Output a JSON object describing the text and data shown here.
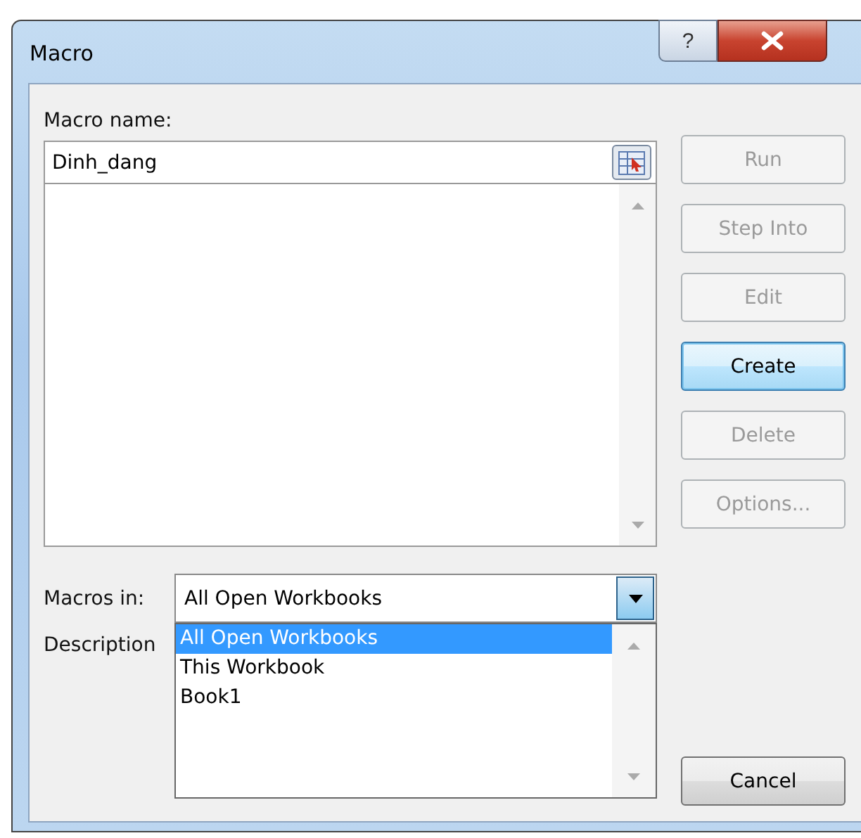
{
  "window": {
    "title": "Macro",
    "help_label": "?"
  },
  "macro_name": {
    "label": "Macro name:",
    "value": "Dinh_dang"
  },
  "buttons": [
    {
      "label": "Run",
      "disabled": true,
      "focused": false
    },
    {
      "label": "Step Into",
      "disabled": true,
      "focused": false
    },
    {
      "label": "Edit",
      "disabled": true,
      "focused": false
    },
    {
      "label": "Create",
      "disabled": false,
      "focused": true
    },
    {
      "label": "Delete",
      "disabled": true,
      "focused": false
    },
    {
      "label": "Options...",
      "disabled": true,
      "focused": false
    }
  ],
  "macros_in": {
    "label": "Macros in:",
    "value": "All Open Workbooks",
    "expanded": true,
    "options": [
      {
        "label": "All Open Workbooks",
        "selected": true
      },
      {
        "label": "This Workbook",
        "selected": false
      },
      {
        "label": "Book1",
        "selected": false
      }
    ]
  },
  "description": {
    "label": "Description"
  },
  "cancel_button": {
    "label": "Cancel"
  }
}
